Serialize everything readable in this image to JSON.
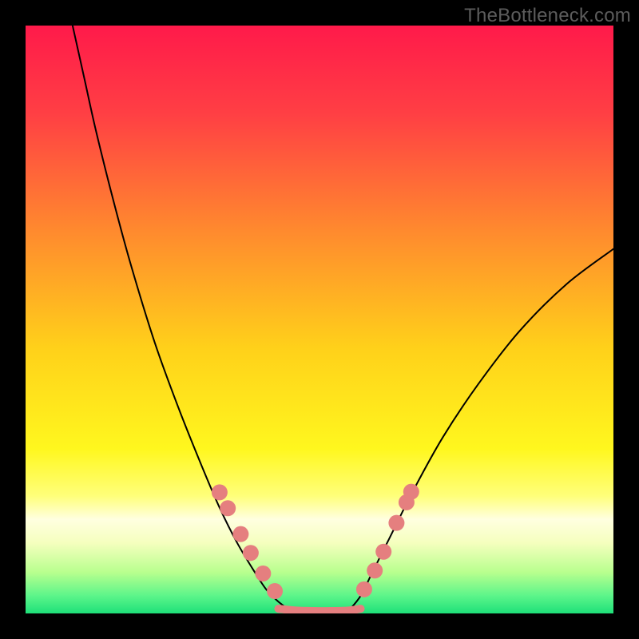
{
  "watermark": "TheBottleneck.com",
  "chart_data": {
    "type": "line",
    "title": "",
    "xlabel": "",
    "ylabel": "",
    "xlim": [
      0,
      100
    ],
    "ylim": [
      0,
      100
    ],
    "grid": false,
    "background": {
      "gradient_stops": [
        {
          "offset": 0.0,
          "color": "#ff1a4a"
        },
        {
          "offset": 0.15,
          "color": "#ff3f44"
        },
        {
          "offset": 0.35,
          "color": "#ff8a2e"
        },
        {
          "offset": 0.55,
          "color": "#ffd11a"
        },
        {
          "offset": 0.72,
          "color": "#fff71e"
        },
        {
          "offset": 0.8,
          "color": "#ffff7a"
        },
        {
          "offset": 0.84,
          "color": "#ffffe0"
        },
        {
          "offset": 0.88,
          "color": "#f5ffbe"
        },
        {
          "offset": 0.93,
          "color": "#b8ff8e"
        },
        {
          "offset": 0.97,
          "color": "#5cf58a"
        },
        {
          "offset": 1.0,
          "color": "#1ee079"
        }
      ]
    },
    "series": [
      {
        "name": "left-curve",
        "stroke": "#000000",
        "stroke_width": 2,
        "x": [
          8,
          10,
          12,
          15,
          18,
          22,
          26,
          30,
          33,
          36,
          39,
          41,
          43,
          45
        ],
        "y": [
          100,
          91,
          82,
          70,
          59,
          46,
          35,
          25,
          18,
          12,
          7,
          4,
          2,
          0.5
        ]
      },
      {
        "name": "right-curve",
        "stroke": "#000000",
        "stroke_width": 2,
        "x": [
          55,
          57,
          59,
          62,
          66,
          71,
          77,
          84,
          92,
          100
        ],
        "y": [
          0.5,
          3,
          7,
          13,
          21,
          30,
          39,
          48,
          56,
          62
        ]
      },
      {
        "name": "valley-band",
        "stroke": "#e57f7f",
        "stroke_width": 10,
        "x": [
          43,
          46,
          49,
          52,
          55,
          57
        ],
        "y": [
          0.8,
          0.5,
          0.4,
          0.4,
          0.5,
          0.8
        ]
      }
    ],
    "markers": [
      {
        "name": "left-beads",
        "fill": "#e57f7f",
        "radius": 10,
        "points": [
          {
            "x": 33.0,
            "y": 20.6
          },
          {
            "x": 34.4,
            "y": 17.9
          },
          {
            "x": 36.6,
            "y": 13.5
          },
          {
            "x": 38.3,
            "y": 10.3
          },
          {
            "x": 40.4,
            "y": 6.8
          },
          {
            "x": 42.4,
            "y": 3.8
          }
        ]
      },
      {
        "name": "right-beads",
        "fill": "#e57f7f",
        "radius": 10,
        "points": [
          {
            "x": 57.6,
            "y": 4.1
          },
          {
            "x": 59.4,
            "y": 7.3
          },
          {
            "x": 60.9,
            "y": 10.5
          },
          {
            "x": 63.1,
            "y": 15.4
          },
          {
            "x": 64.8,
            "y": 18.9
          },
          {
            "x": 65.6,
            "y": 20.7
          }
        ]
      }
    ]
  }
}
